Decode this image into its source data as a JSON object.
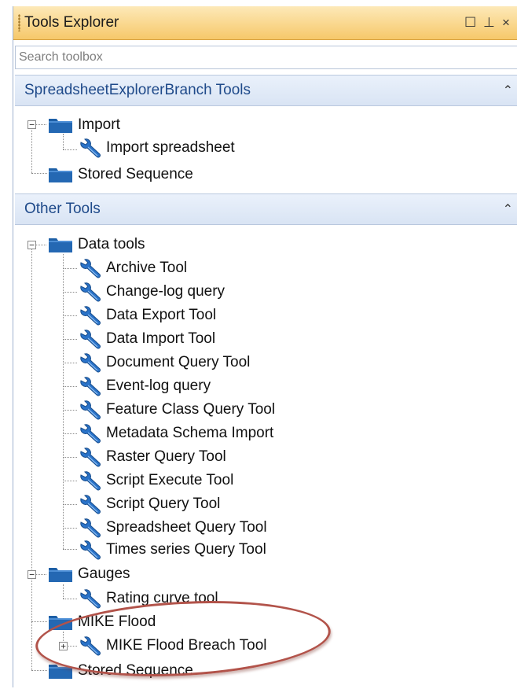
{
  "window": {
    "title": "Tools Explorer",
    "buttons": {
      "float": "☐",
      "pin": "⊥",
      "close": "×"
    }
  },
  "search": {
    "placeholder": "Search toolbox",
    "value": ""
  },
  "sections": [
    {
      "title": "SpreadsheetExplorerBranch Tools",
      "collapse_glyph": "⌃",
      "items": {
        "import_folder": "Import",
        "import_spreadsheet": "Import  spreadsheet",
        "stored_sequence": "Stored Sequence"
      }
    },
    {
      "title": "Other Tools",
      "collapse_glyph": "⌃",
      "items": {
        "data_tools_folder": "Data tools",
        "data_tools": [
          "Archive Tool",
          "Change-log query",
          "Data Export Tool",
          "Data Import Tool",
          "Document Query Tool",
          "Event-log query",
          "Feature Class Query Tool",
          "Metadata Schema Import",
          "Raster Query Tool",
          "Script Execute Tool",
          "Script Query Tool",
          "Spreadsheet Query Tool",
          "Times series Query Tool"
        ],
        "gauges_folder": "Gauges",
        "rating_curve_tool": "Rating curve tool",
        "mike_flood_folder": "MIKE Flood",
        "mike_flood_breach_tool": "MIKE Flood Breach Tool",
        "stored_sequence": "Stored Sequence"
      }
    }
  ],
  "expander_glyphs": {
    "minus": "−",
    "plus": "+"
  },
  "colors": {
    "title_bar": "#f6c86a",
    "section_header": "#d9e4f4",
    "section_text": "#1f4a8a",
    "folder": "#1d5fa6",
    "wrench": "#2a73c9",
    "annotation_ellipse": "#b2534a"
  },
  "icons": {
    "folder": "folder-icon",
    "tool": "wrench-icon",
    "collapse": "chevron-up-icon"
  }
}
